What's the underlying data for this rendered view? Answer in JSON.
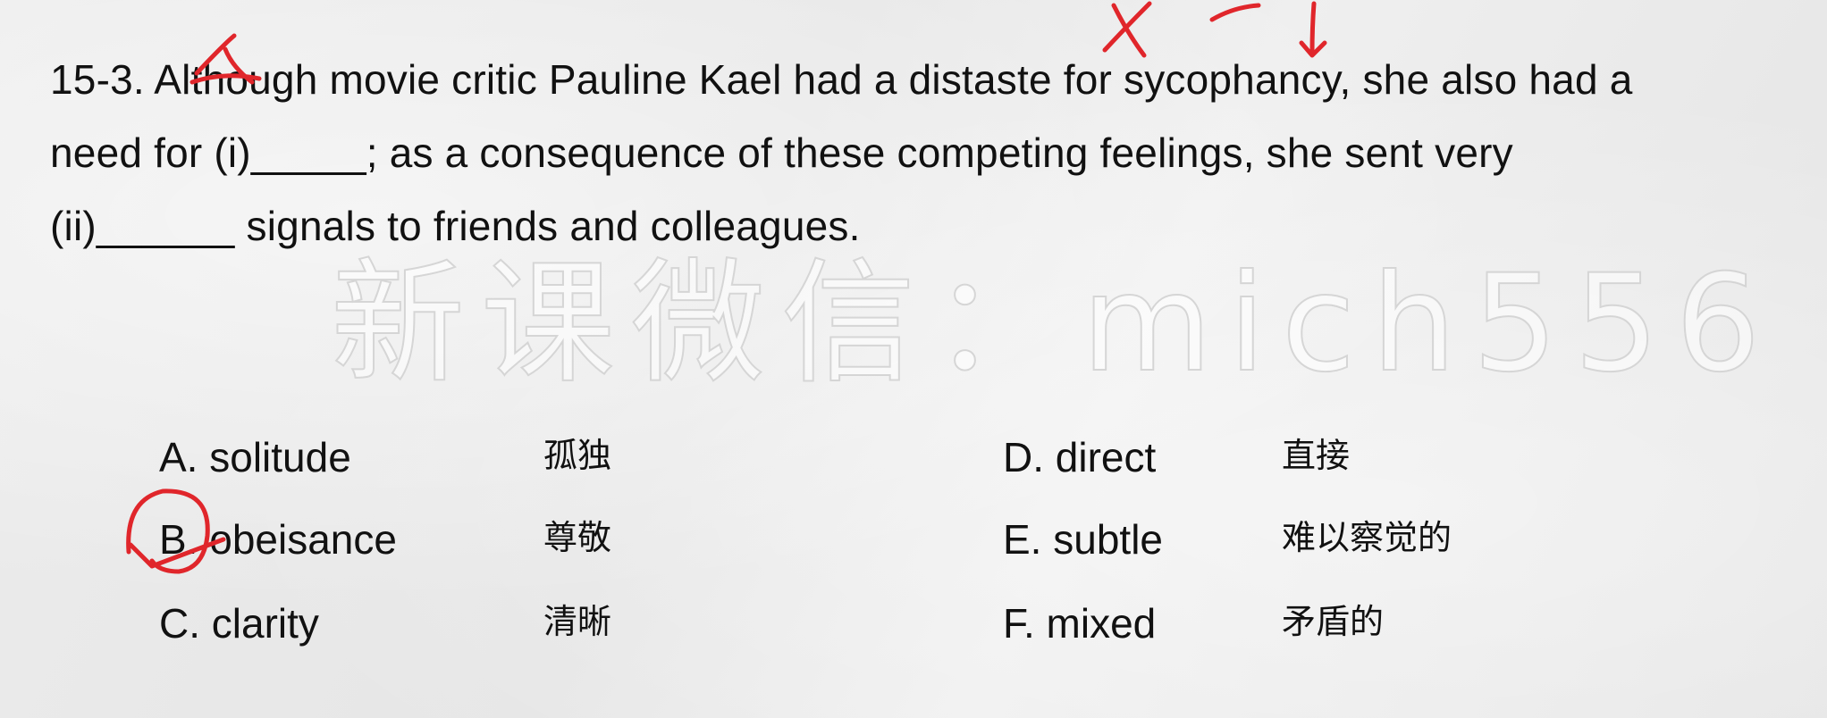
{
  "question": {
    "lines": [
      "15-3. Although movie critic Pauline Kael had a distaste for sycophancy, she also had a",
      "need for (i)_____; as a consequence of these competing feelings, she sent very",
      "(ii)______ signals to friends and colleagues."
    ]
  },
  "watermark": "新课微信：mich556",
  "options": [
    {
      "label": "A. solitude",
      "gloss": "孤独"
    },
    {
      "label": "B. obeisance",
      "gloss": "尊敬"
    },
    {
      "label": "C. clarity",
      "gloss": "清晰"
    },
    {
      "label": "D. direct",
      "gloss": "直接"
    },
    {
      "label": "E. subtle",
      "gloss": "难以察觉的"
    },
    {
      "label": "F. mixed",
      "gloss": "矛盾的"
    }
  ],
  "annotations": {
    "ink_color": "#e0262b",
    "marks": [
      "strike-mark-although",
      "x-mark",
      "arrow-mark",
      "circle-mark-option-b"
    ]
  }
}
